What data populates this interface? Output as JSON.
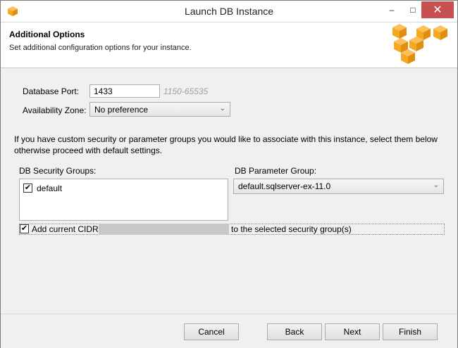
{
  "window": {
    "title": "Launch DB Instance",
    "minimize_glyph": "–",
    "maximize_glyph": "□",
    "close_glyph": "✕"
  },
  "header": {
    "title": "Additional Options",
    "subtitle": "Set additional configuration options for your instance."
  },
  "form": {
    "port_label": "Database Port:",
    "port_value": "1433",
    "port_range": "1150-65535",
    "az_label": "Availability Zone:",
    "az_value": "No preference",
    "info_line1": "If you have custom security or parameter groups you would like to associate with this instance, select them below",
    "info_line2": "otherwise proceed with default settings.",
    "security_groups_label": "DB Security Groups:",
    "security_groups": [
      {
        "label": "default",
        "checked": true
      }
    ],
    "parameter_group_label": "DB Parameter Group:",
    "parameter_group_value": "default.sqlserver-ex-11.0",
    "cidr_prefix": "Add current CIDR",
    "cidr_suffix": "to the selected security group(s)",
    "cidr_checked": true
  },
  "footer": {
    "cancel": "Cancel",
    "back": "Back",
    "next": "Next",
    "finish": "Finish"
  },
  "colors": {
    "logo_orange": "#f7a823",
    "close_red": "#c75050"
  }
}
